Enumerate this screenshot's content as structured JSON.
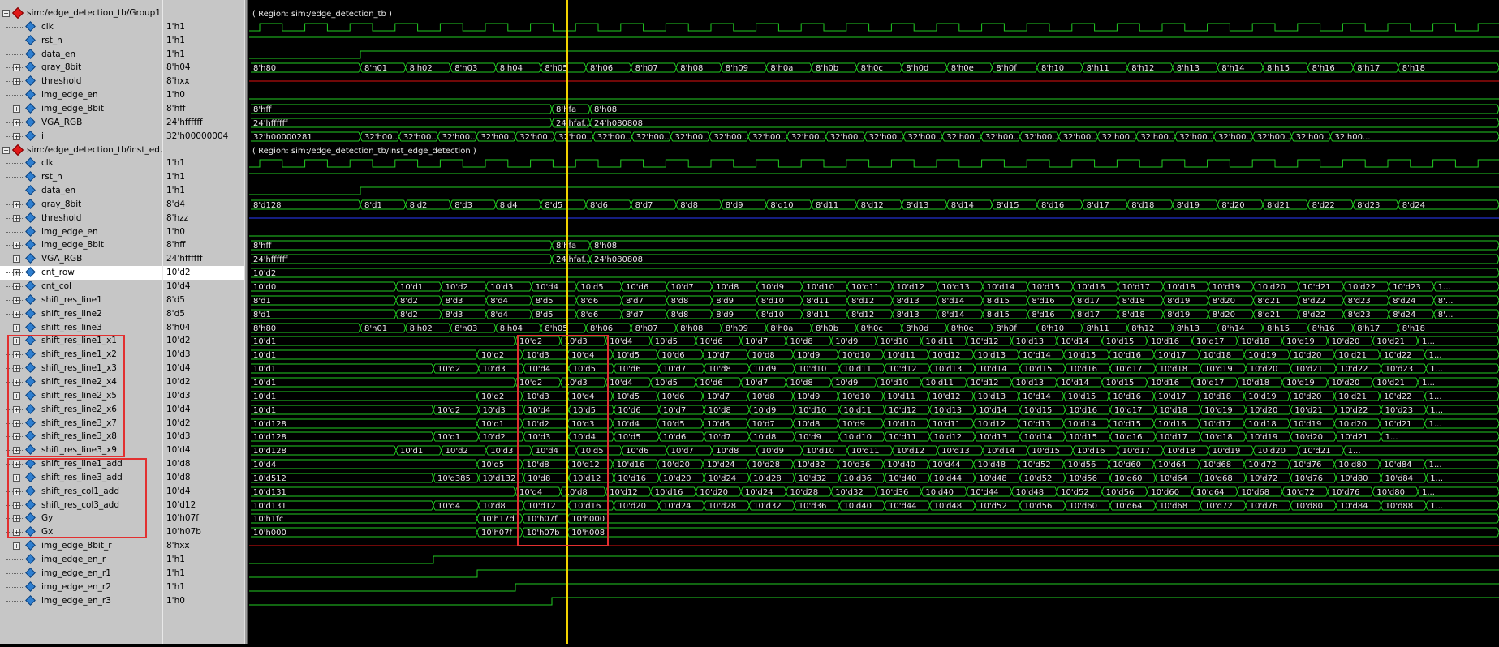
{
  "groups": [
    {
      "header": "sim:/edge_detection_tb/Group1",
      "region_label": "( Region: sim:/edge_detection_tb )"
    },
    {
      "header": "sim:/edge_detection_tb/inst_ed...",
      "region_label": "( Region: sim:/edge_detection_tb/inst_edge_detection )"
    }
  ],
  "signals": [
    {
      "name": "sim:/edge_detection_tb/Group1",
      "value": "",
      "kind": "group"
    },
    {
      "name": "clk",
      "value": "1'h1",
      "kind": "clock"
    },
    {
      "name": "rst_n",
      "value": "1'h1",
      "kind": "bit"
    },
    {
      "name": "data_en",
      "value": "1'h1",
      "kind": "bit"
    },
    {
      "name": "gray_8bit",
      "value": "8'h04",
      "kind": "bus",
      "expand": true
    },
    {
      "name": "threshold",
      "value": "8'hxx",
      "kind": "xbus",
      "expand": true
    },
    {
      "name": "img_edge_en",
      "value": "1'h0",
      "kind": "bit"
    },
    {
      "name": "img_edge_8bit",
      "value": "8'hff",
      "kind": "bus",
      "expand": true
    },
    {
      "name": "VGA_RGB",
      "value": "24'hffffff",
      "kind": "bus",
      "expand": true
    },
    {
      "name": "i",
      "value": "32'h00000004",
      "kind": "bus",
      "expand": true
    },
    {
      "name": "sim:/edge_detection_tb/inst_ed...",
      "value": "",
      "kind": "group"
    },
    {
      "name": "clk",
      "value": "1'h1",
      "kind": "clock"
    },
    {
      "name": "rst_n",
      "value": "1'h1",
      "kind": "bit"
    },
    {
      "name": "data_en",
      "value": "1'h1",
      "kind": "bit"
    },
    {
      "name": "gray_8bit",
      "value": "8'd4",
      "kind": "bus",
      "expand": true
    },
    {
      "name": "threshold",
      "value": "8'hzz",
      "kind": "zbus",
      "expand": true
    },
    {
      "name": "img_edge_en",
      "value": "1'h0",
      "kind": "bit"
    },
    {
      "name": "img_edge_8bit",
      "value": "8'hff",
      "kind": "bus",
      "expand": true
    },
    {
      "name": "VGA_RGB",
      "value": "24'hffffff",
      "kind": "bus",
      "expand": true
    },
    {
      "name": "cnt_row",
      "value": "10'd2",
      "kind": "bus",
      "expand": true,
      "selected": true
    },
    {
      "name": "cnt_col",
      "value": "10'd4",
      "kind": "bus",
      "expand": true
    },
    {
      "name": "shift_res_line1",
      "value": "8'd5",
      "kind": "bus",
      "expand": true
    },
    {
      "name": "shift_res_line2",
      "value": "8'd5",
      "kind": "bus",
      "expand": true
    },
    {
      "name": "shift_res_line3",
      "value": "8'h04",
      "kind": "bus",
      "expand": true
    },
    {
      "name": "shift_res_line1_x1",
      "value": "10'd2",
      "kind": "bus",
      "expand": true
    },
    {
      "name": "shift_res_line1_x2",
      "value": "10'd3",
      "kind": "bus",
      "expand": true
    },
    {
      "name": "shift_res_line1_x3",
      "value": "10'd4",
      "kind": "bus",
      "expand": true
    },
    {
      "name": "shift_res_line2_x4",
      "value": "10'd2",
      "kind": "bus",
      "expand": true
    },
    {
      "name": "shift_res_line2_x5",
      "value": "10'd3",
      "kind": "bus",
      "expand": true
    },
    {
      "name": "shift_res_line2_x6",
      "value": "10'd4",
      "kind": "bus",
      "expand": true
    },
    {
      "name": "shift_res_line3_x7",
      "value": "10'd2",
      "kind": "bus",
      "expand": true
    },
    {
      "name": "shift_res_line3_x8",
      "value": "10'd3",
      "kind": "bus",
      "expand": true
    },
    {
      "name": "shift_res_line3_x9",
      "value": "10'd4",
      "kind": "bus",
      "expand": true
    },
    {
      "name": "shift_res_line1_add",
      "value": "10'd8",
      "kind": "bus",
      "expand": true
    },
    {
      "name": "shift_res_line3_add",
      "value": "10'd8",
      "kind": "bus",
      "expand": true
    },
    {
      "name": "shift_res_col1_add",
      "value": "10'd4",
      "kind": "bus",
      "expand": true
    },
    {
      "name": "shift_res_col3_add",
      "value": "10'd12",
      "kind": "bus",
      "expand": true
    },
    {
      "name": "Gy",
      "value": "10'h07f",
      "kind": "bus",
      "expand": true
    },
    {
      "name": "Gx",
      "value": "10'h07b",
      "kind": "bus",
      "expand": true
    },
    {
      "name": "img_edge_8bit_r",
      "value": "8'hxx",
      "kind": "xbus",
      "expand": true
    },
    {
      "name": "img_edge_en_r",
      "value": "1'h1",
      "kind": "bit"
    },
    {
      "name": "img_edge_en_r1",
      "value": "1'h1",
      "kind": "bit"
    },
    {
      "name": "img_edge_en_r2",
      "value": "1'h1",
      "kind": "bit"
    },
    {
      "name": "img_edge_en_r3",
      "value": "1'h0",
      "kind": "bit"
    }
  ],
  "wave_labels": {
    "gray_hex": [
      "8'h80",
      "8'h01",
      "8'h02",
      "8'h03",
      "8'h04",
      "8'h05",
      "8'h06",
      "8'h07",
      "8'h08",
      "8'h09",
      "8'h0a",
      "8'h0b",
      "8'h0c",
      "8'h0d",
      "8'h0e",
      "8'h0f",
      "8'h10",
      "8'h11",
      "8'h12",
      "8'h13",
      "8'h14",
      "8'h15",
      "8'h16",
      "8'h17",
      "8'h18"
    ],
    "img_edge_8bit": [
      "8'hff",
      "8'hfa",
      "8'h08"
    ],
    "vga_rgb": [
      "24'hffffff",
      "24'hfaf...",
      "24'h080808"
    ],
    "i_vals": [
      "32'h00000281",
      "32'h00..."
    ],
    "gray_dec": [
      "8'd128",
      "8'd1",
      "8'd2",
      "8'd3",
      "8'd4",
      "8'd5",
      "8'd6",
      "8'd7",
      "8'd8",
      "8'd9",
      "8'd10",
      "8'd11",
      "8'd12",
      "8'd13",
      "8'd14",
      "8'd15",
      "8'd16",
      "8'd17",
      "8'd18",
      "8'd19",
      "8'd20",
      "8'd21",
      "8'd22",
      "8'd23",
      "8'd24"
    ],
    "cnt_row": [
      "10'd2"
    ],
    "cnt_col": [
      "10'd0",
      "10'd1",
      "10'd2",
      "10'd3",
      "10'd4",
      "10'd5",
      "10'd6",
      "10'd7",
      "10'd8",
      "10'd9",
      "10'd10",
      "10'd11",
      "10'd12",
      "10'd13",
      "10'd14",
      "10'd15",
      "10'd16",
      "10'd17",
      "10'd18",
      "10'd19",
      "10'd20",
      "10'd21",
      "10'd22",
      "10'd23",
      "1..."
    ],
    "srl1": [
      "8'd1",
      "8'd2",
      "8'd3",
      "8'd4",
      "8'd5",
      "8'd6",
      "8'd7",
      "8'd8",
      "8'd9",
      "8'd10",
      "8'd11",
      "8'd12",
      "8'd13",
      "8'd14",
      "8'd15",
      "8'd16",
      "8'd17",
      "8'd18",
      "8'd19",
      "8'd20",
      "8'd21",
      "8'd22",
      "8'd23",
      "8'd24",
      "8'..."
    ],
    "srl2": [
      "8'd1",
      "8'd2",
      "8'd3",
      "8'd4",
      "8'd5",
      "8'd6",
      "8'd7",
      "8'd8",
      "8'd9",
      "8'd10",
      "8'd11",
      "8'd12",
      "8'd13",
      "8'd14",
      "8'd15",
      "8'd16",
      "8'd17",
      "8'd18",
      "8'd19",
      "8'd20",
      "8'd21",
      "8'd22",
      "8'd23",
      "8'd24",
      "8'..."
    ],
    "srl3": [
      "8'h80",
      "8'h01",
      "8'h02",
      "8'h03",
      "8'h04",
      "8'h05",
      "8'h06",
      "8'h07",
      "8'h08",
      "8'h09",
      "8'h0a",
      "8'h0b",
      "8'h0c",
      "8'h0d",
      "8'h0e",
      "8'h0f",
      "8'h10",
      "8'h11",
      "8'h12",
      "8'h13",
      "8'h14",
      "8'h15",
      "8'h16",
      "8'h17",
      "8'h18"
    ],
    "x1": [
      "10'd1",
      "10'd2",
      "10'd3",
      "10'd4",
      "10'd5",
      "10'd6",
      "10'd7",
      "10'd8",
      "10'd9",
      "10'd10",
      "10'd11",
      "10'd12",
      "10'd13",
      "10'd14",
      "10'd15",
      "10'd16",
      "10'd17",
      "10'd18",
      "10'd19",
      "10'd20",
      "10'd21",
      "1..."
    ],
    "x2": [
      "10'd1",
      "10'd2",
      "10'd3",
      "10'd4",
      "10'd5",
      "10'd6",
      "10'd7",
      "10'd8",
      "10'd9",
      "10'd10",
      "10'd11",
      "10'd12",
      "10'd13",
      "10'd14",
      "10'd15",
      "10'd16",
      "10'd17",
      "10'd18",
      "10'd19",
      "10'd20",
      "10'd21",
      "10'd22",
      "1..."
    ],
    "x3": [
      "10'd1",
      "10'd2",
      "10'd3",
      "10'd4",
      "10'd5",
      "10'd6",
      "10'd7",
      "10'd8",
      "10'd9",
      "10'd10",
      "10'd11",
      "10'd12",
      "10'd13",
      "10'd14",
      "10'd15",
      "10'd16",
      "10'd17",
      "10'd18",
      "10'd19",
      "10'd20",
      "10'd21",
      "10'd22",
      "10'd23",
      "1..."
    ],
    "x7": [
      "10'd128",
      "10'd1",
      "10'd2",
      "10'd3",
      "10'd4",
      "10'd5",
      "10'd6",
      "10'd7",
      "10'd8",
      "10'd9",
      "10'd10",
      "10'd11",
      "10'd12",
      "10'd13",
      "10'd14",
      "10'd15",
      "10'd16",
      "10'd17",
      "10'd18",
      "10'd19",
      "10'd20",
      "10'd21",
      "1..."
    ],
    "l1add": [
      "10'd4",
      "10'd5",
      "10'd8",
      "10'd12",
      "10'd16",
      "10'd20",
      "10'd24",
      "10'd28",
      "10'd32",
      "10'd36",
      "10'd40",
      "10'd44",
      "10'd48",
      "10'd52",
      "10'd56",
      "10'd60",
      "10'd64",
      "10'd68",
      "10'd72",
      "10'd76",
      "10'd80",
      "10'd84",
      "1..."
    ],
    "l3add": [
      "10'd512",
      "10'd385",
      "10'd132",
      "10'd8",
      "10'd12",
      "10'd16",
      "10'd20",
      "10'd24",
      "10'd28",
      "10'd32",
      "10'd36",
      "10'd40",
      "10'd44",
      "10'd48",
      "10'd52",
      "10'd56",
      "10'd60",
      "10'd64",
      "10'd68",
      "10'd72",
      "10'd76",
      "10'd80",
      "10'd84",
      "1..."
    ],
    "c1add": [
      "10'd131",
      "10'd4",
      "10'd8",
      "10'd12",
      "10'd16",
      "10'd20",
      "10'd24",
      "10'd28",
      "10'd32",
      "10'd36",
      "10'd40",
      "10'd44",
      "10'd48",
      "10'd52",
      "10'd56",
      "10'd60",
      "10'd64",
      "10'd68",
      "10'd72",
      "10'd76",
      "10'd80",
      "1..."
    ],
    "c3add": [
      "10'd131",
      "10'd4",
      "10'd8",
      "10'd12",
      "10'd16",
      "10'd20",
      "10'd24",
      "10'd28",
      "10'd32",
      "10'd36",
      "10'd40",
      "10'd44",
      "10'd48",
      "10'd52",
      "10'd56",
      "10'd60",
      "10'd64",
      "10'd68",
      "10'd72",
      "10'd76",
      "10'd80",
      "10'd84",
      "10'd88",
      "1..."
    ],
    "gy": [
      "10'h1fc",
      "10'h17d",
      "10'h07f",
      "10'h000"
    ],
    "gx": [
      "10'h000",
      "10'h07f",
      "10'h07b",
      "10'h008"
    ]
  },
  "colors": {
    "wave": "#22cc22",
    "xstate": "#e01010",
    "zstate": "#2a3cff",
    "cursor": "#f2d200",
    "highlight_box": "#e23030",
    "label_text": "#e8e8e8"
  }
}
